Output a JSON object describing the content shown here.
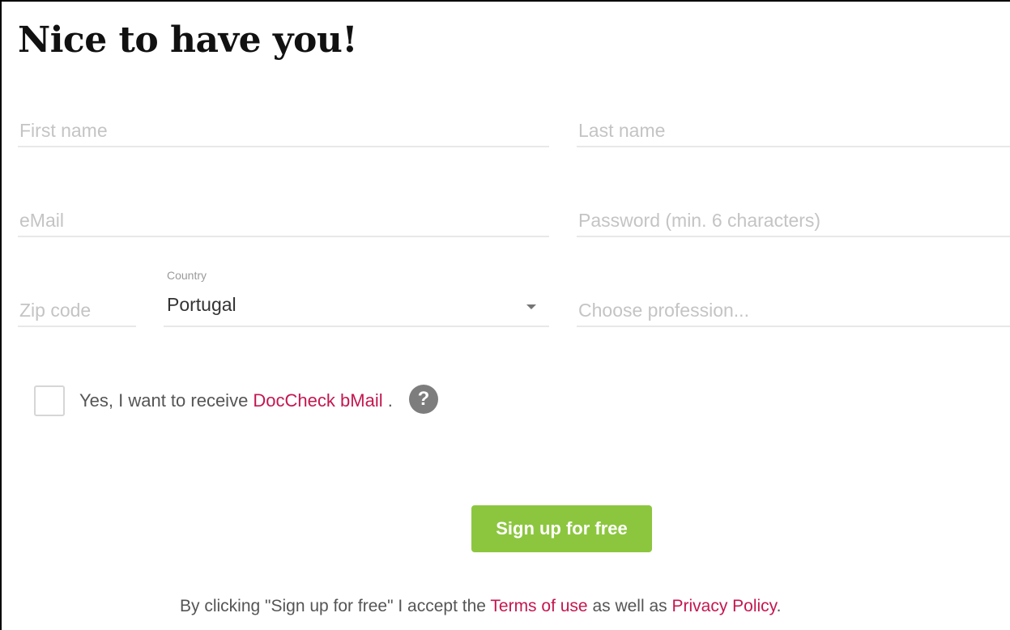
{
  "page": {
    "title": "Nice to have you!"
  },
  "form": {
    "first_name": {
      "placeholder": "First name",
      "value": ""
    },
    "last_name": {
      "placeholder": "Last name",
      "value": ""
    },
    "email": {
      "placeholder": "eMail",
      "value": ""
    },
    "password": {
      "placeholder": "Password (min. 6 characters)",
      "value": ""
    },
    "zip": {
      "placeholder": "Zip code",
      "value": ""
    },
    "country": {
      "label": "Country",
      "value": "Portugal"
    },
    "profession": {
      "placeholder": "Choose profession...",
      "value": ""
    }
  },
  "newsletter": {
    "checked": false,
    "text_before": "Yes, I want to receive ",
    "link_label": "DocCheck bMail",
    "text_after": " .",
    "help_icon": "question-circle-icon",
    "help_glyph": "?"
  },
  "actions": {
    "signup_label": "Sign up for free"
  },
  "legal": {
    "text_before": "By clicking \"Sign up for free\" I accept the ",
    "terms_label": "Terms of use",
    "text_middle": " as well as ",
    "privacy_label": "Privacy Policy",
    "text_after": "."
  },
  "colors": {
    "link": "#c4174f",
    "button": "#8cc63f",
    "field_line": "#e8e8e8",
    "placeholder": "#c4c4c4"
  }
}
